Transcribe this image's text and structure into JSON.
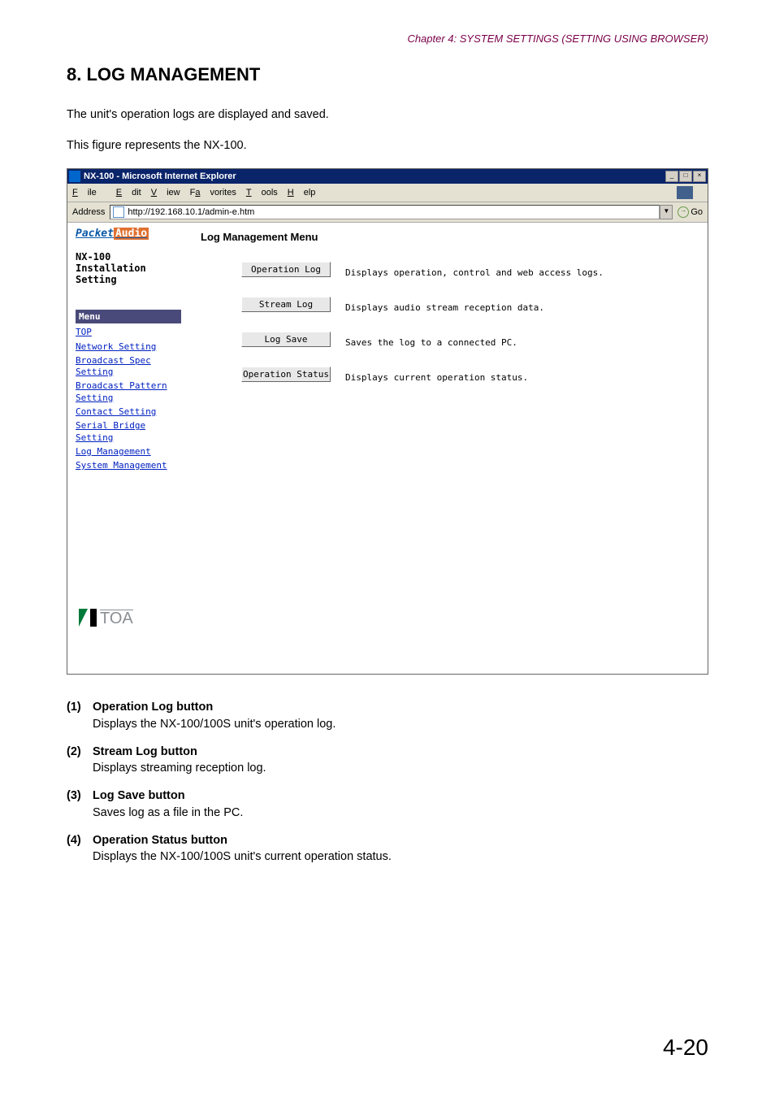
{
  "chapter_header": "Chapter 4:  SYSTEM SETTINGS (SETTING USING BROWSER)",
  "section_title": "8. LOG MANAGEMENT",
  "intro_text": "The unit's operation logs are displayed and saved.",
  "figure_text": "This figure represents the NX-100.",
  "browser": {
    "title": "NX-100 - Microsoft Internet Explorer",
    "menu": {
      "file": "File",
      "edit": "Edit",
      "view": "View",
      "favorites": "Favorites",
      "tools": "Tools",
      "help": "Help"
    },
    "address_label": "Address",
    "address_url": "http://192.168.10.1/admin-e.htm",
    "go_label": "Go"
  },
  "sidebar": {
    "logo_packet": "Packet",
    "logo_audio": "Audio",
    "device": "NX-100",
    "install": "Installation Setting",
    "menu_header": "Menu",
    "links": {
      "top": "TOP",
      "network": "Network Setting",
      "bspec": "Broadcast Spec Setting",
      "bpattern": "Broadcast Pattern Setting",
      "contact": "Contact Setting",
      "serial": "Serial Bridge Setting",
      "logmgmt": "Log Management",
      "sysmgmt": "System Management"
    },
    "toa": "TOA"
  },
  "panel": {
    "title": "Log Management Menu",
    "rows": [
      {
        "btn": "Operation Log",
        "desc": "Displays operation, control and web access logs."
      },
      {
        "btn": "Stream Log",
        "desc": "Displays audio stream reception data."
      },
      {
        "btn": "Log Save",
        "desc": "Saves the log to a connected PC."
      },
      {
        "btn": "Operation Status",
        "desc": "Displays current operation status."
      }
    ]
  },
  "descriptions": [
    {
      "num": "(1)",
      "title": "Operation Log button",
      "body": "Displays the NX-100/100S unit's operation log."
    },
    {
      "num": "(2)",
      "title": "Stream Log button",
      "body": "Displays streaming reception log."
    },
    {
      "num": "(3)",
      "title": "Log Save button",
      "body": "Saves log as a file in the PC."
    },
    {
      "num": "(4)",
      "title": "Operation Status button",
      "body": "Displays the NX-100/100S unit's current operation status."
    }
  ],
  "page_number": "4-20"
}
